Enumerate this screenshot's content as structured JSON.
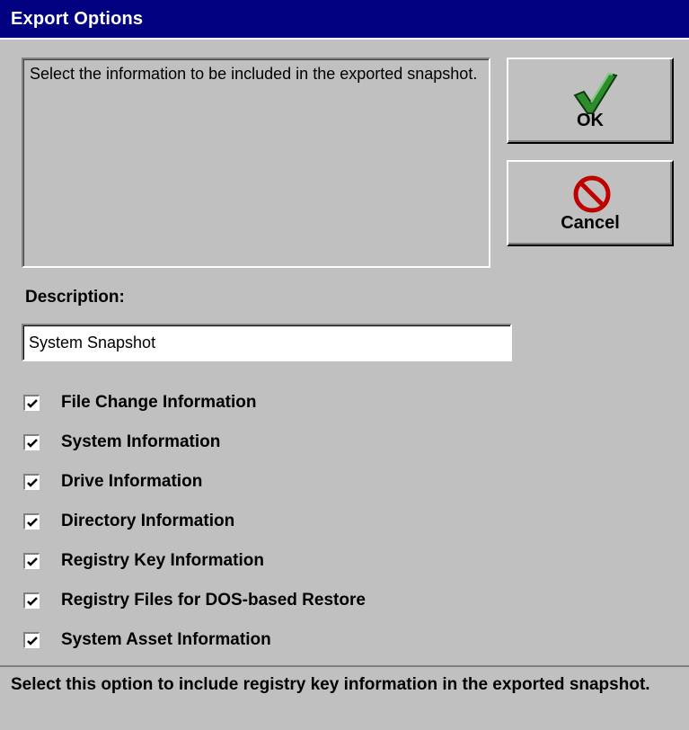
{
  "window": {
    "title": "Export Options"
  },
  "info_box": {
    "text": "Select the information to be included in the exported snapshot."
  },
  "buttons": {
    "ok": {
      "label": "OK",
      "icon": "checkmark-icon"
    },
    "cancel": {
      "label": "Cancel",
      "icon": "no-entry-icon"
    }
  },
  "description": {
    "label": "Description:",
    "value": "System Snapshot"
  },
  "options": [
    {
      "label": "File Change Information",
      "checked": true
    },
    {
      "label": "System Information",
      "checked": true
    },
    {
      "label": "Drive Information",
      "checked": true
    },
    {
      "label": "Directory Information",
      "checked": true
    },
    {
      "label": "Registry Key Information",
      "checked": true
    },
    {
      "label": "Registry Files for DOS-based Restore",
      "checked": true
    },
    {
      "label": "System Asset Information",
      "checked": true
    }
  ],
  "status": {
    "text": "Select this option to include registry key information in the exported snapshot."
  },
  "colors": {
    "title_bar": "#000080",
    "face": "#c0c0c0",
    "check_green": "#2e8b2e",
    "cancel_red": "#c00000"
  }
}
